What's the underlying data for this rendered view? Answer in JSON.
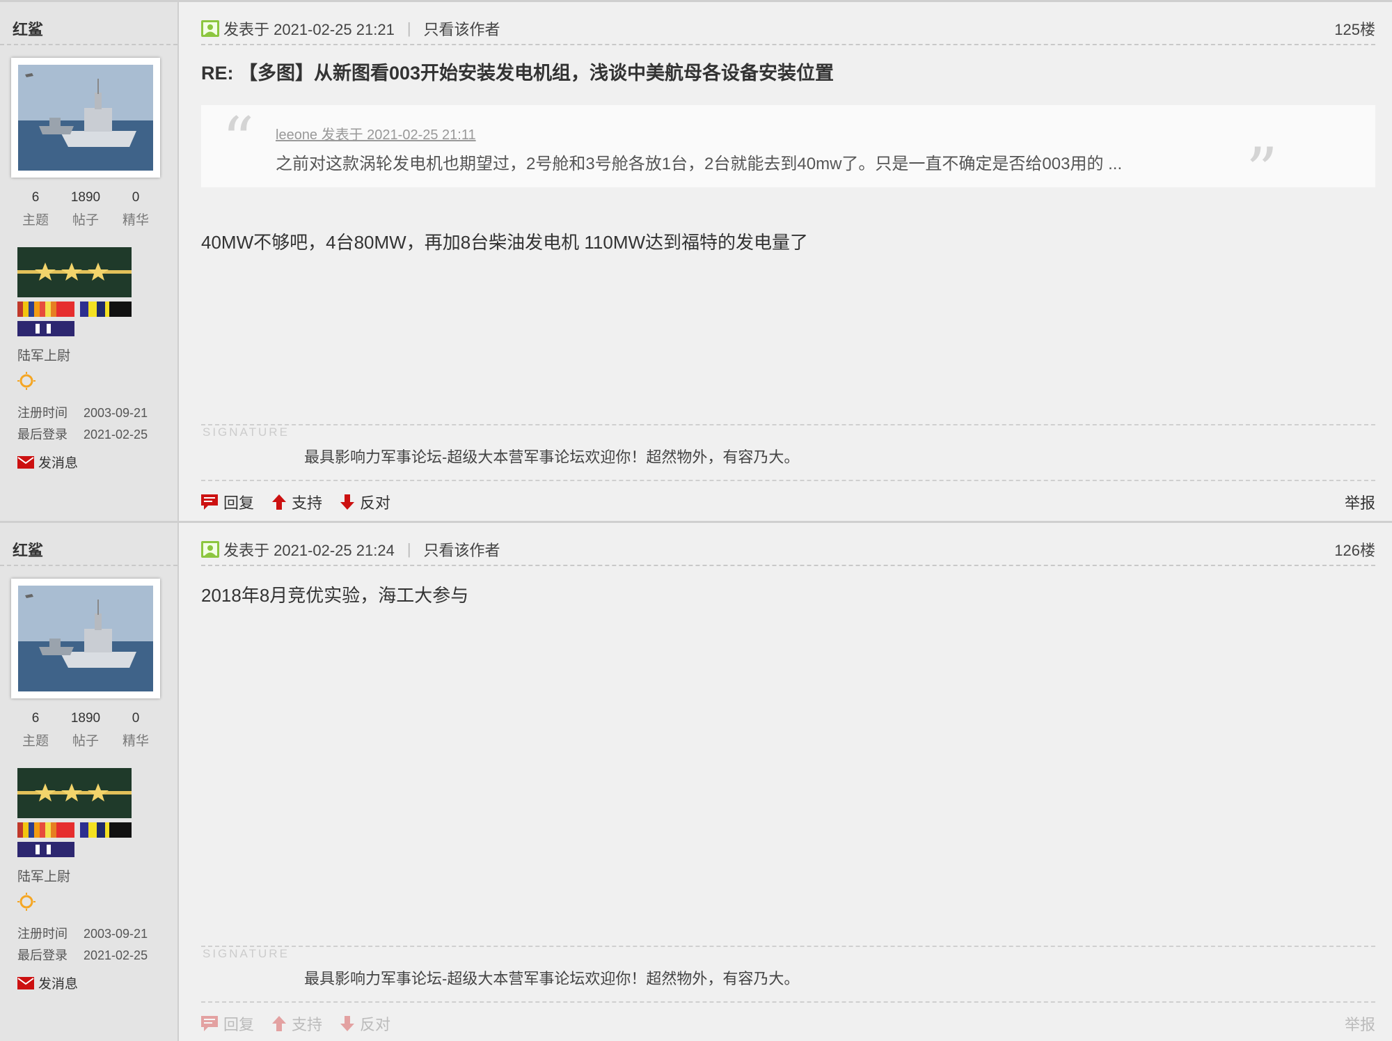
{
  "posts": [
    {
      "user": {
        "name": "红鲨",
        "stats": [
          {
            "value": "6",
            "label": "主题"
          },
          {
            "value": "1890",
            "label": "帖子"
          },
          {
            "value": "0",
            "label": "精华"
          }
        ],
        "rank": "陆军上尉",
        "reg_label": "注册时间",
        "reg_date": "2003-09-21",
        "login_label": "最后登录",
        "login_date": "2021-02-25",
        "message_label": "发消息"
      },
      "posted": "发表于 2021-02-25 21:21",
      "only_author": "只看该作者",
      "floor": "125楼",
      "title": "RE: 【多图】从新图看003开始安装发电机组，浅谈中美航母各设备安装位置",
      "quote": {
        "meta": "leeone 发表于 2021-02-25 21:11",
        "text": "之前对这款涡轮发电机也期望过，2号舱和3号舱各放1台，2台就能去到40mw了。只是一直不确定是否给003用的 ..."
      },
      "body": "40MW不够吧，4台80MW，再加8台柴油发电机 110MW达到福特的发电量了",
      "signature_label": "SIGNATURE",
      "signature": "最具影响力军事论坛-超级大本营军事论坛欢迎你！超然物外，有容乃大。",
      "actions": {
        "reply": "回复",
        "support": "支持",
        "oppose": "反对",
        "report": "举报"
      }
    },
    {
      "user": {
        "name": "红鲨",
        "stats": [
          {
            "value": "6",
            "label": "主题"
          },
          {
            "value": "1890",
            "label": "帖子"
          },
          {
            "value": "0",
            "label": "精华"
          }
        ],
        "rank": "陆军上尉",
        "reg_label": "注册时间",
        "reg_date": "2003-09-21",
        "login_label": "最后登录",
        "login_date": "2021-02-25",
        "message_label": "发消息"
      },
      "posted": "发表于 2021-02-25 21:24",
      "only_author": "只看该作者",
      "floor": "126楼",
      "body": "2018年8月竞优实验，海工大参与",
      "signature_label": "SIGNATURE",
      "signature": "最具影响力军事论坛-超级大本营军事论坛欢迎你！超然物外，有容乃大。",
      "actions": {
        "reply": "回复",
        "support": "支持",
        "oppose": "反对",
        "report": "举报"
      }
    }
  ],
  "colors": {
    "accent_red": "#cc1111",
    "post_icon_green": "#8cc63f",
    "sun_orange": "#f5a623"
  }
}
